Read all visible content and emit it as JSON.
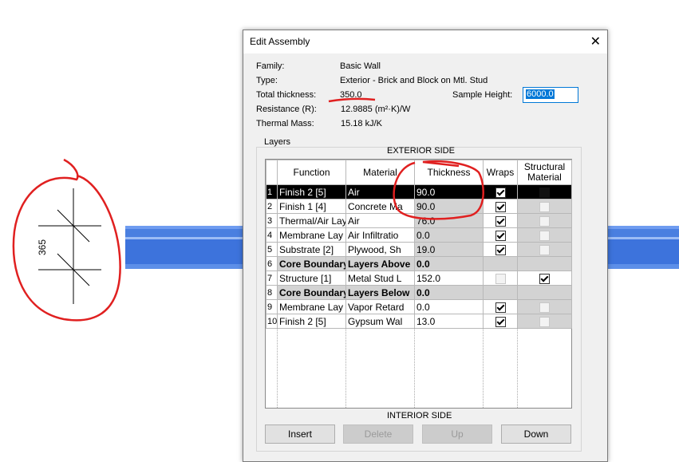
{
  "dialog": {
    "title": "Edit Assembly",
    "close_glyph": "✕"
  },
  "props": {
    "family_label": "Family:",
    "family_value": "Basic Wall",
    "type_label": "Type:",
    "type_value": "Exterior - Brick and Block on Mtl. Stud",
    "thickness_label": "Total thickness:",
    "thickness_value": "350.0",
    "resistance_label": "Resistance (R):",
    "resistance_value": "12.9885 (m²·K)/W",
    "mass_label": "Thermal Mass:",
    "mass_value": "15.18 kJ/K",
    "sample_label": "Sample Height:",
    "sample_value": "6000.0"
  },
  "layers": {
    "group_label": "Layers",
    "exterior_label": "EXTERIOR SIDE",
    "interior_label": "INTERIOR SIDE",
    "headers": [
      "Function",
      "Material",
      "Thickness",
      "Wraps",
      "Structural Material"
    ],
    "rows": [
      {
        "num": "1",
        "function": "Finish 2 [5]",
        "material": "Air",
        "thickness": "90.0",
        "wraps": true,
        "structural": false
      },
      {
        "num": "2",
        "function": "Finish 1 [4]",
        "material": "Concrete Ma",
        "thickness": "90.0",
        "wraps": true,
        "structural": false
      },
      {
        "num": "3",
        "function": "Thermal/Air Lay",
        "material": "Air",
        "thickness": "76.0",
        "wraps": true,
        "structural": false
      },
      {
        "num": "4",
        "function": "Membrane Lay",
        "material": "Air Infiltratio",
        "thickness": "0.0",
        "wraps": true,
        "structural": false
      },
      {
        "num": "5",
        "function": "Substrate [2]",
        "material": "Plywood, Sh",
        "thickness": "19.0",
        "wraps": true,
        "structural": false
      },
      {
        "num": "6",
        "function": "Core Boundary",
        "material": "Layers Above",
        "thickness": "0.0"
      },
      {
        "num": "7",
        "function": "Structure [1]",
        "material": "Metal Stud L",
        "thickness": "152.0",
        "wraps": false,
        "structural": true
      },
      {
        "num": "8",
        "function": "Core Boundary",
        "material": "Layers Below",
        "thickness": "0.0"
      },
      {
        "num": "9",
        "function": "Membrane Lay",
        "material": "Vapor Retard",
        "thickness": "0.0",
        "wraps": true,
        "structural": false
      },
      {
        "num": "10",
        "function": "Finish 2 [5]",
        "material": "Gypsum Wal",
        "thickness": "13.0",
        "wraps": true,
        "structural": false
      }
    ]
  },
  "buttons": {
    "insert": "Insert",
    "delete": "Delete",
    "up": "Up",
    "down": "Down"
  },
  "canvas": {
    "dimension_text": "365",
    "annotation_color": "#e02020",
    "wall_color": "#4a7fe0"
  }
}
